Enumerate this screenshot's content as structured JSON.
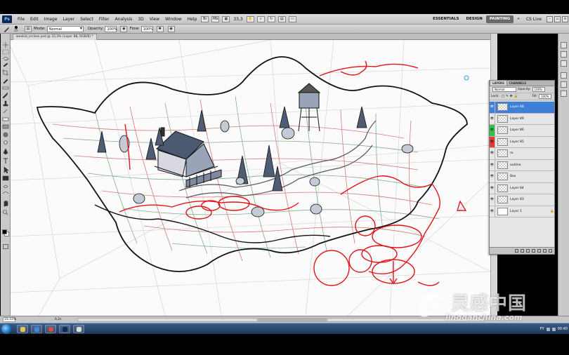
{
  "menubar": {
    "items": [
      "File",
      "Edit",
      "Image",
      "Layer",
      "Select",
      "Filter",
      "Analysis",
      "3D",
      "View",
      "Window",
      "Help"
    ],
    "zoom": "33,3",
    "workspaces": [
      "ESSENTIALS",
      "DESIGN",
      "PAINTING"
    ],
    "active_workspace": "PAINTING",
    "cs_live": "CS Live"
  },
  "options": {
    "brush_size": "15",
    "mode_label": "Mode:",
    "mode_value": "Normal",
    "opacity_label": "Opacity:",
    "opacity_value": "100%",
    "flow_label": "Flow:",
    "flow_value": "100%"
  },
  "document": {
    "tab_title": "wexkid_inclass.psd @ 33,3% (Layer 88, RGB/8) *"
  },
  "layers_panel": {
    "tabs": [
      "LAYERS",
      "CHANNELS"
    ],
    "blend_mode": "Normal",
    "opacity_label": "Opacity:",
    "opacity_value": "100%",
    "lock_label": "Lock:",
    "fill_label": "Fill:",
    "fill_value": "100%",
    "layers": [
      {
        "name": "Layer 88",
        "selected": true,
        "eye_color": "#ffffff"
      },
      {
        "name": "Layer 89",
        "selected": false,
        "eye_color": "#000000"
      },
      {
        "name": "Layer 86",
        "selected": false,
        "eye_color": "#35c24a"
      },
      {
        "name": "Layer 85",
        "selected": false,
        "eye_color": "#e03a3a"
      },
      {
        "name": "ro",
        "selected": false,
        "eye_color": "#000000"
      },
      {
        "name": "outline",
        "selected": false,
        "eye_color": "#000000"
      },
      {
        "name": "Box",
        "selected": false,
        "eye_color": "#000000"
      },
      {
        "name": "Layer 84",
        "selected": false,
        "eye_color": "#000000"
      },
      {
        "name": "Layer 83",
        "selected": false,
        "eye_color": "#000000"
      },
      {
        "name": "Layer 1",
        "selected": false,
        "eye_color": "#000000",
        "white_thumb": true,
        "locked": true
      }
    ]
  },
  "statusbar": {
    "zoom": "33,33%",
    "doc_size": "6,2s"
  },
  "taskbar": {
    "time": "00:40",
    "lang": "FY"
  },
  "watermark": {
    "text": "灵感中国",
    "url": "lingganchina.com"
  },
  "colors": {
    "sketch_red": "#e0141a",
    "grid_red": "#d47a7a",
    "grid_green": "#7fb08a",
    "ink": "#111111",
    "selection_blue": "#3d7fd9"
  }
}
